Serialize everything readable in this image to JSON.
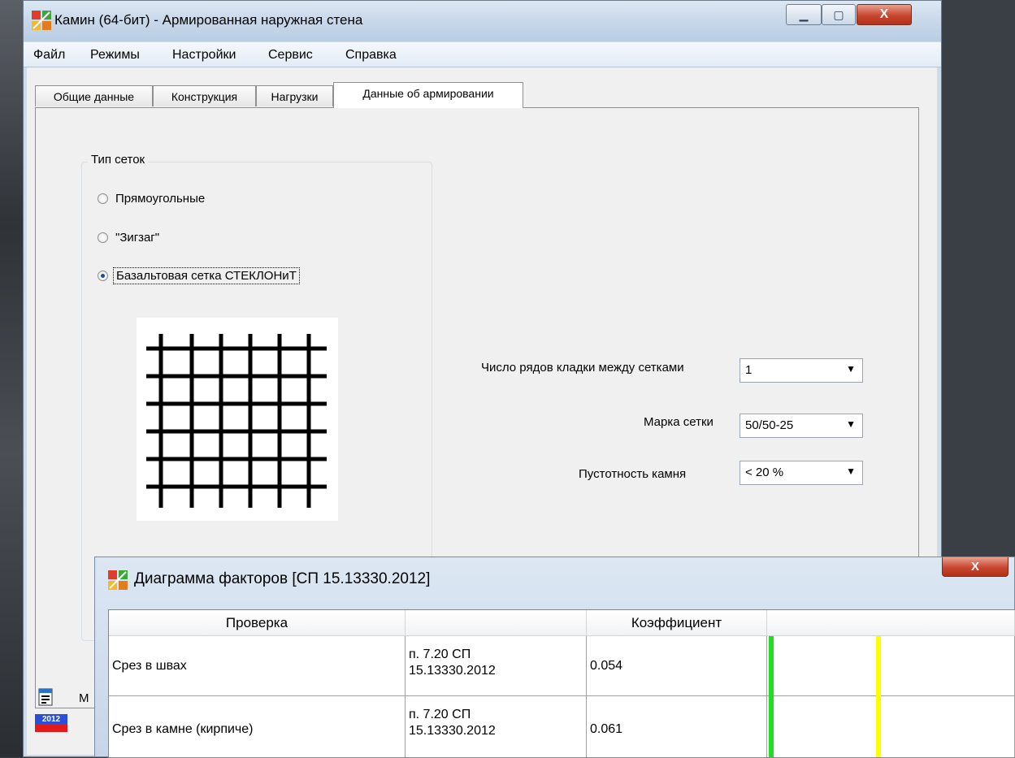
{
  "window": {
    "title": "Камин (64-бит) - Армированная наружная стена",
    "minimize_symbol": "▁",
    "maximize_symbol": "▢",
    "close_symbol": "X"
  },
  "menu": [
    "Файл",
    "Режимы",
    "Настройки",
    "Сервис",
    "Справка"
  ],
  "tabs": [
    {
      "label": "Общие данные",
      "active": false
    },
    {
      "label": "Конструкция",
      "active": false
    },
    {
      "label": "Нагрузки",
      "active": false
    },
    {
      "label": "Данные об армировании",
      "active": true
    }
  ],
  "mesh_type": {
    "title": "Тип сеток",
    "options": [
      "Прямоугольные",
      "\"Зигзаг\"",
      "Базальтовая сетка СТЕКЛОНиТ"
    ],
    "selected_index": 2
  },
  "fields": {
    "rows_between": {
      "label": "Число рядов кладки между сетками",
      "value": "1"
    },
    "mesh_grade": {
      "label": "Марка сетки",
      "value": "50/50-25"
    },
    "stone_voidness": {
      "label": "Пустотность камня",
      "value": "< 20 %"
    }
  },
  "status": {
    "partial_letter": "М",
    "badge": "2012"
  },
  "diagram": {
    "title": "Диаграмма факторов [СП 15.13330.2012]",
    "close_symbol": "X",
    "columns": [
      "Проверка",
      "",
      "Коэффициент",
      ""
    ],
    "rows": [
      {
        "check": "Срез в швах",
        "ref_line1": "п. 7.20 СП",
        "ref_line2": "15.13330.2012",
        "coefficient": "0.054"
      },
      {
        "check": "Срез в камне (кирпиче)",
        "ref_line1": "п. 7.20 СП",
        "ref_line2": "15.13330.2012",
        "coefficient": "0.061"
      }
    ],
    "colors": {
      "green_bar": "#22dd22",
      "yellow_bar": "#ffff00"
    }
  },
  "colors": {
    "accent_close": "#c7462f",
    "title_bar": "#c8d8ea"
  }
}
